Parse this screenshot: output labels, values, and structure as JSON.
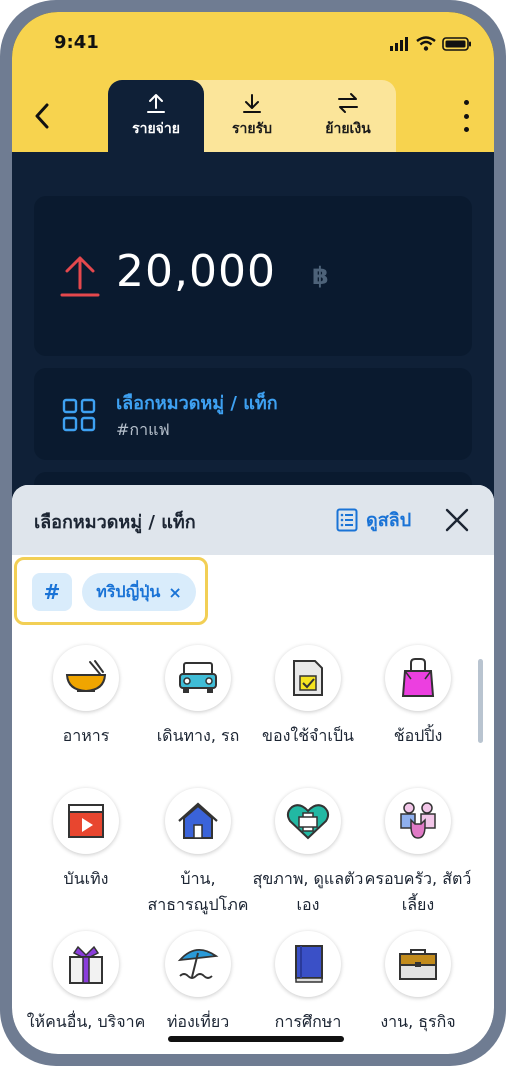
{
  "status": {
    "time": "9:41"
  },
  "tabs": [
    {
      "label": "รายจ่าย",
      "icon": "upload-arrow-icon",
      "active": true
    },
    {
      "label": "รายรับ",
      "icon": "download-arrow-icon",
      "active": false
    },
    {
      "label": "ย้ายเงิน",
      "icon": "transfer-arrows-icon",
      "active": false
    }
  ],
  "amount": {
    "value": "20,000",
    "currency": "฿"
  },
  "category": {
    "title": "เลือกหมวดหมู่ / แท็ก",
    "tag": "#กาแฟ"
  },
  "sheet": {
    "title": "เลือกหมวดหมู่ / แท็ก",
    "view_slip": "ดูสลิป",
    "hash": "#",
    "selected_tag": "ทริปญี่ปุ่น",
    "tag_remove": "×"
  },
  "categories": [
    {
      "label": "อาหาร",
      "icon": "food-bowl-icon"
    },
    {
      "label": "เดินทาง, รถ",
      "icon": "car-icon"
    },
    {
      "label": "ของใช้จำเป็น",
      "icon": "checklist-icon"
    },
    {
      "label": "ช้อปปิ้ง",
      "icon": "shopping-bag-icon"
    },
    {
      "label": "บันเทิง",
      "icon": "video-play-icon"
    },
    {
      "label": "บ้าน, สาธารณูปโภค",
      "icon": "house-icon"
    },
    {
      "label": "สุขภาพ, ดูแลตัวเอง",
      "icon": "health-heart-icon"
    },
    {
      "label": "ครอบครัว, สัตว์เลี้ยง",
      "icon": "family-pet-icon"
    },
    {
      "label": "ให้คนอื่น, บริจาค",
      "icon": "gift-icon"
    },
    {
      "label": "ท่องเที่ยว",
      "icon": "beach-umbrella-icon"
    },
    {
      "label": "การศึกษา",
      "icon": "book-icon"
    },
    {
      "label": "งาน, ธุรกิจ",
      "icon": "briefcase-icon"
    }
  ],
  "colors": {
    "brand_yellow": "#F7D34E",
    "navy": "#0F2037",
    "accent_blue": "#1A73D6",
    "expense_red": "#E5484D"
  }
}
